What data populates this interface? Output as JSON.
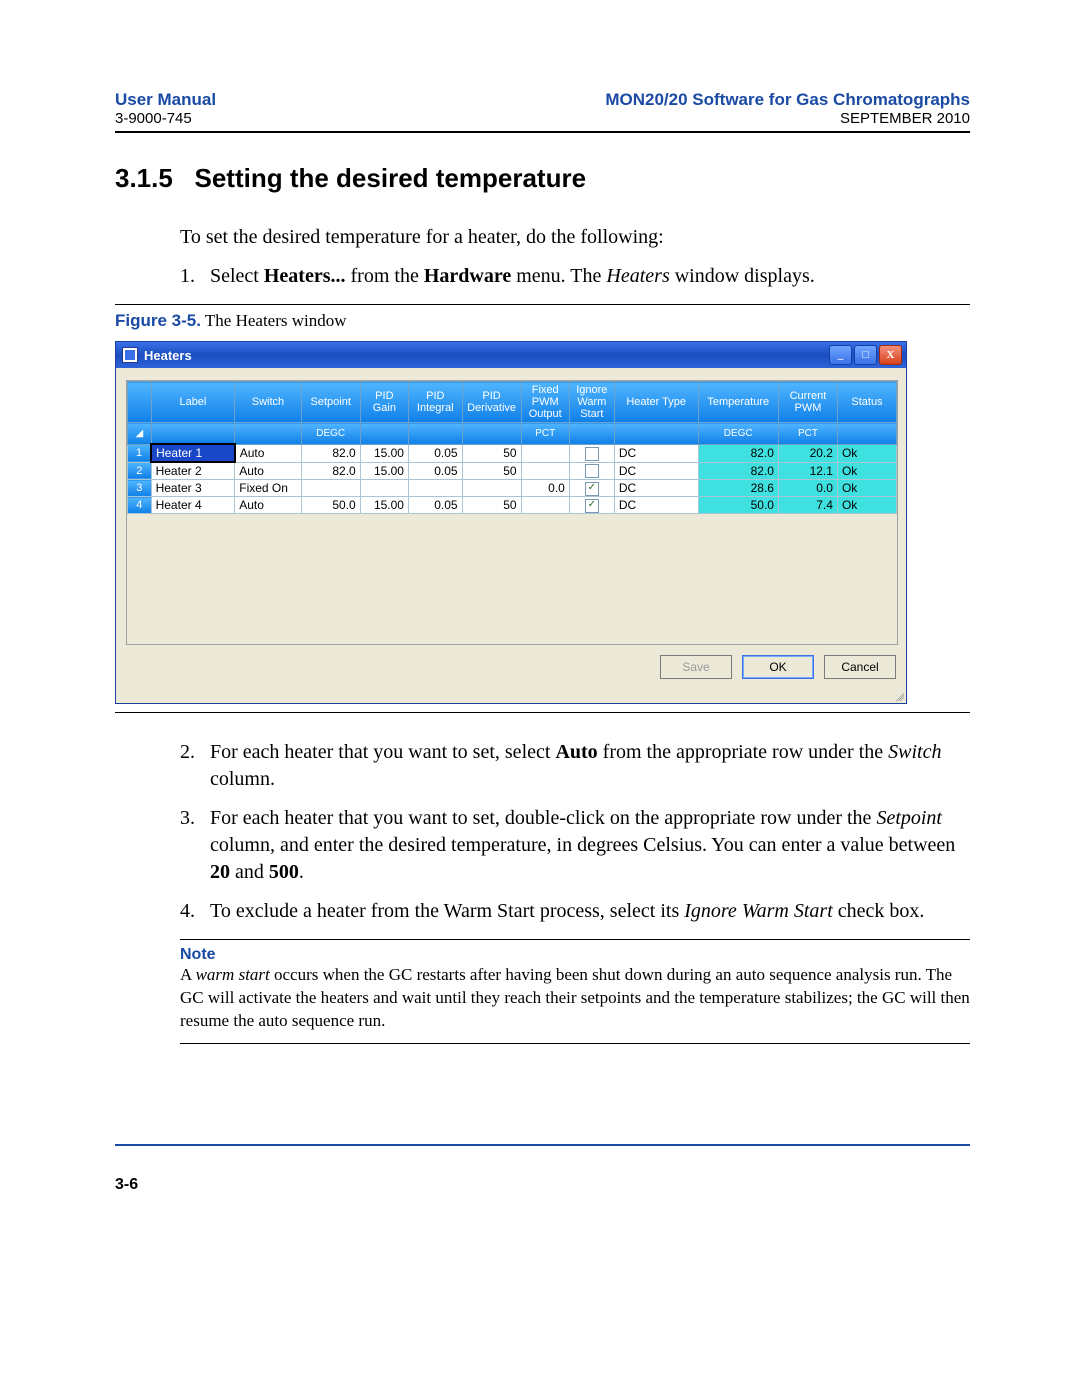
{
  "header": {
    "left_title": "User Manual",
    "left_sub": "3-9000-745",
    "right_title": "MON20/20 Software for Gas Chromatographs",
    "right_sub": "SEPTEMBER 2010"
  },
  "section": {
    "number": "3.1.5",
    "title": "Setting the desired temperature"
  },
  "intro": "To set the desired temperature for a heater, do the following:",
  "steps": {
    "s1_num": "1.",
    "s1_a": "Select ",
    "s1_b": "Heaters...",
    "s1_c": " from the ",
    "s1_d": "Hardware",
    "s1_e": " menu.  The ",
    "s1_f": "Heaters",
    "s1_g": " window displays.",
    "s2_num": "2.",
    "s2_a": "For each heater that you want to set, select ",
    "s2_b": "Auto",
    "s2_c": " from the appropriate row under the ",
    "s2_d": "Switch",
    "s2_e": " column.",
    "s3_num": "3.",
    "s3_a": "For each heater that you want to set, double-click on the appropriate row under the ",
    "s3_b": "Setpoint",
    "s3_c": " column, and enter the desired temperature, in degrees Celsius.  You can enter a value between ",
    "s3_d": "20",
    "s3_e": " and ",
    "s3_f": "500",
    "s3_g": ".",
    "s4_num": "4.",
    "s4_a": "To exclude a heater from the Warm Start process, select its ",
    "s4_b": "Ignore Warm Start",
    "s4_c": " check box."
  },
  "figure": {
    "label": "Figure 3-5.",
    "caption": "  The Heaters window"
  },
  "window": {
    "title": "Heaters",
    "columns": [
      "",
      "Label",
      "Switch",
      "Setpoint",
      "PID Gain",
      "PID Integral",
      "PID Derivative",
      "Fixed PWM Output",
      "Ignore Warm Start",
      "Heater Type",
      "Temperature",
      "Current PWM",
      "Status"
    ],
    "units": [
      "",
      "",
      "",
      "DEGC",
      "",
      "",
      "",
      "PCT",
      "",
      "",
      "DEGC",
      "PCT",
      ""
    ],
    "rows": [
      {
        "n": "1",
        "label": "Heater 1",
        "switch": "Auto",
        "setpoint": "82.0",
        "gain": "15.00",
        "integral": "0.05",
        "deriv": "50",
        "fixed": "",
        "ignore": false,
        "type": "DC",
        "temp": "82.0",
        "pwm": "20.2",
        "status": "Ok"
      },
      {
        "n": "2",
        "label": "Heater 2",
        "switch": "Auto",
        "setpoint": "82.0",
        "gain": "15.00",
        "integral": "0.05",
        "deriv": "50",
        "fixed": "",
        "ignore": false,
        "type": "DC",
        "temp": "82.0",
        "pwm": "12.1",
        "status": "Ok"
      },
      {
        "n": "3",
        "label": "Heater 3",
        "switch": "Fixed On",
        "setpoint": "",
        "gain": "",
        "integral": "",
        "deriv": "",
        "fixed": "0.0",
        "ignore": true,
        "type": "DC",
        "temp": "28.6",
        "pwm": "0.0",
        "status": "Ok"
      },
      {
        "n": "4",
        "label": "Heater 4",
        "switch": "Auto",
        "setpoint": "50.0",
        "gain": "15.00",
        "integral": "0.05",
        "deriv": "50",
        "fixed": "",
        "ignore": true,
        "type": "DC",
        "temp": "50.0",
        "pwm": "7.4",
        "status": "Ok"
      }
    ],
    "buttons": {
      "save": "Save",
      "ok": "OK",
      "cancel": "Cancel"
    },
    "min_glyph": "_",
    "max_glyph": "□",
    "close_glyph": "X"
  },
  "note": {
    "label": "Note",
    "a": "A ",
    "b": "warm start",
    "c": " occurs when the GC restarts after having been shut down during an auto sequence analysis run.  The GC will activate the heaters and wait until they reach their setpoints and the temperature stabilizes; the GC will then resume the auto sequence run."
  },
  "page_number": "3-6"
}
